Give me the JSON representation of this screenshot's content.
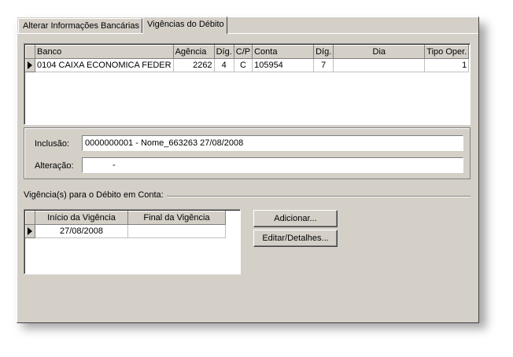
{
  "tabs": [
    {
      "label": "Alterar Informações Bancárias"
    },
    {
      "label": "Vigências do Débito"
    }
  ],
  "bank_grid": {
    "headers": [
      "Banco",
      "Agência",
      "Díg.",
      "C/P",
      "Conta",
      "Díg.",
      "Dia",
      "Tipo Oper."
    ],
    "rows": [
      {
        "banco": "0104  CAIXA ECONOMICA FEDER",
        "agencia": "2262",
        "dig1": "4",
        "cp": "C",
        "conta": "105954",
        "dig2": "7",
        "dia": "",
        "tipo_oper": "1"
      }
    ]
  },
  "fields": {
    "inclusao_label": "Inclusão:",
    "inclusao_value": "0000000001 - Nome_663263  27/08/2008",
    "alteracao_label": "Alteração:",
    "alteracao_value": "-"
  },
  "vigencias": {
    "group_label": "Vigência(s) para o Débito em Conta:",
    "headers": [
      "Início da Vigência",
      "Final da Vigência"
    ],
    "rows": [
      {
        "inicio": "27/08/2008",
        "final": ""
      }
    ]
  },
  "buttons": {
    "adicionar": "Adicionar...",
    "editar": "Editar/Detalhes..."
  }
}
